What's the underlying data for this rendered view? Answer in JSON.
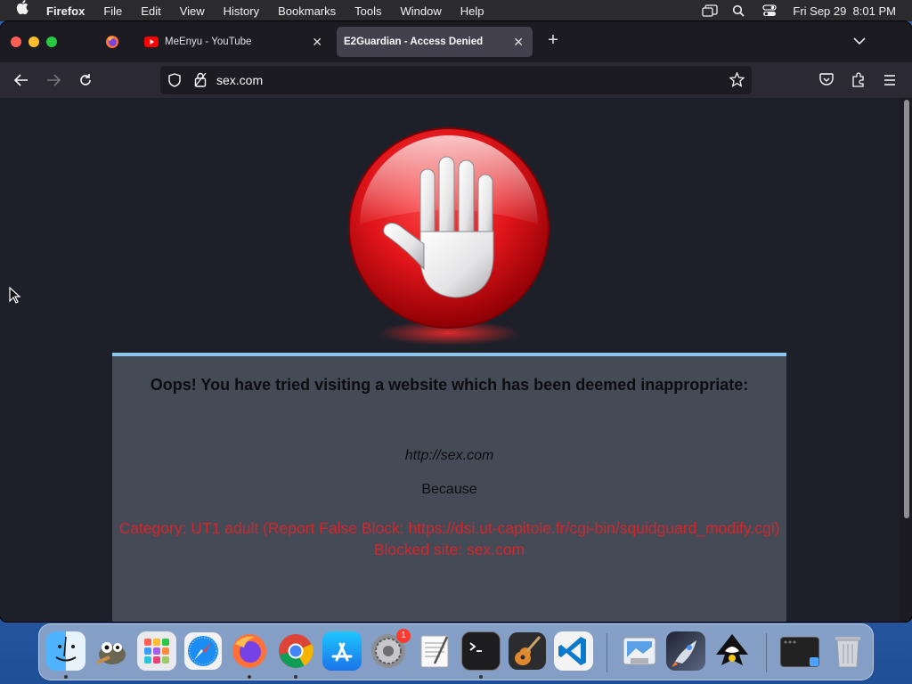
{
  "menubar": {
    "app_name": "Firefox",
    "items": [
      "File",
      "Edit",
      "View",
      "History",
      "Bookmarks",
      "Tools",
      "Window",
      "Help"
    ],
    "clock": "Fri Sep 29  8:01 PM"
  },
  "tabs": [
    {
      "title": "MeEnyu - YouTube",
      "favicon": "youtube-icon",
      "active": false
    },
    {
      "title": "E2Guardian - Access Denied",
      "favicon": "none",
      "active": true
    }
  ],
  "navbar": {
    "url": "sex.com"
  },
  "page": {
    "heading": "Oops! You have tried visiting a website which has been deemed inappropriate:",
    "blocked_url": "http://sex.com",
    "because": "Because",
    "reason_line1": "Category: UT1 adult (Report False Block: https://dsi.ut-capitole.fr/cgi-bin/squidguard_modify.cgi)",
    "reason_line2": "Blocked site: sex.com",
    "reason_color": "#d4262a"
  },
  "dock": {
    "apps": [
      "finder-icon",
      "gimp-icon",
      "launchpad-icon",
      "safari-icon",
      "firefox-icon",
      "chrome-icon",
      "app-store-icon",
      "system-settings-icon",
      "textedit-icon",
      "terminal-icon",
      "garageband-icon",
      "vscode-icon",
      "preview-icon",
      "rocket-icon",
      "inkscape-icon",
      "window-icon",
      "trash-icon"
    ],
    "settings_badge": "1"
  }
}
